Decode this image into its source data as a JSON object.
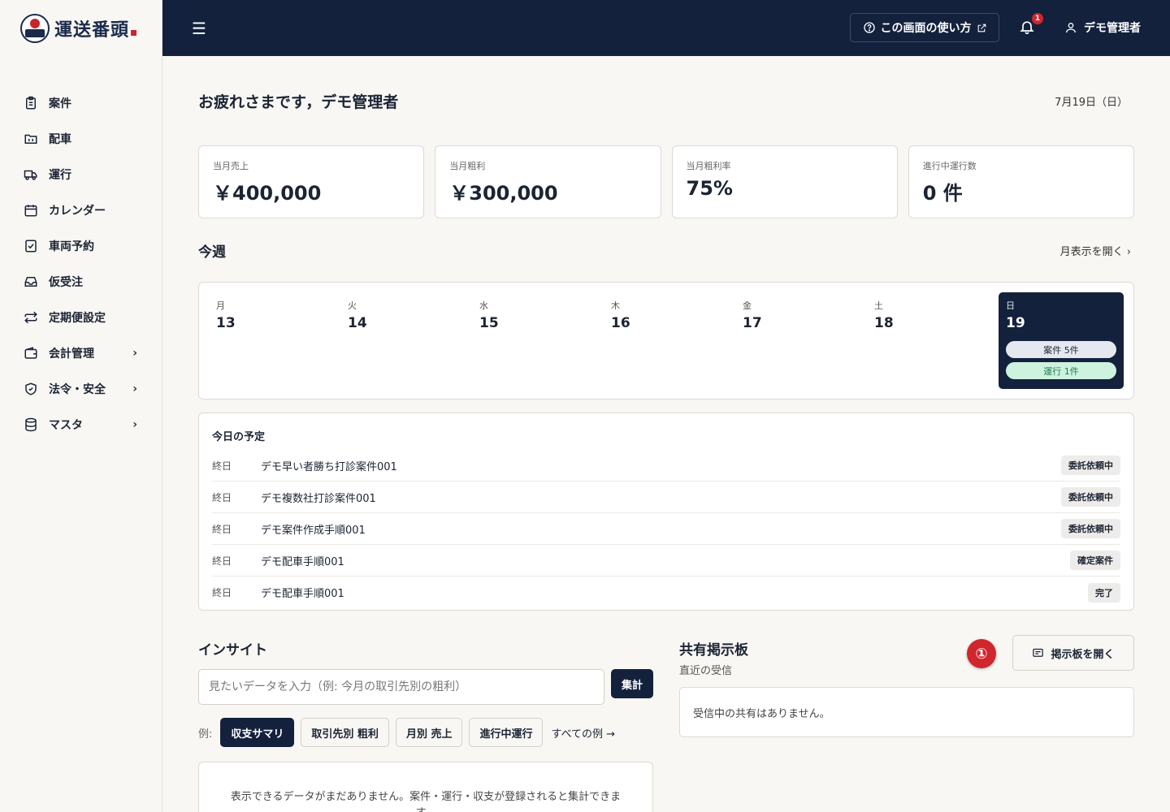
{
  "app": {
    "logo_text": "運送番頭"
  },
  "sidebar": {
    "items": [
      {
        "label": "案件",
        "icon": "clipboard-icon"
      },
      {
        "label": "配車",
        "icon": "folder-icon"
      },
      {
        "label": "運行",
        "icon": "truck-icon"
      },
      {
        "label": "カレンダー",
        "icon": "calendar-icon"
      },
      {
        "label": "車両予約",
        "icon": "checklist-icon"
      },
      {
        "label": "仮受注",
        "icon": "inbox-icon"
      },
      {
        "label": "定期便設定",
        "icon": "repeat-icon"
      },
      {
        "label": "会計管理",
        "icon": "wallet-icon",
        "expandable": true
      },
      {
        "label": "法令・安全",
        "icon": "shield-icon",
        "expandable": true
      },
      {
        "label": "マスタ",
        "icon": "database-icon",
        "expandable": true
      }
    ]
  },
  "header": {
    "help_label": "この画面の使い方",
    "notification_count": "1",
    "user_name": "デモ管理者"
  },
  "greeting": {
    "text": "お疲れさまです，デモ管理者",
    "date": "7月19日（日）"
  },
  "kpis": [
    {
      "label": "当月売上",
      "value": "￥400,000"
    },
    {
      "label": "当月粗利",
      "value": "￥300,000"
    },
    {
      "label": "当月粗利率",
      "value": "75%"
    },
    {
      "label": "進行中運行数",
      "value": "0 件"
    }
  ],
  "week": {
    "title": "今週",
    "open_month_label": "月表示を開く",
    "days": [
      {
        "name": "月",
        "num": "13"
      },
      {
        "name": "火",
        "num": "14"
      },
      {
        "name": "水",
        "num": "15"
      },
      {
        "name": "木",
        "num": "16"
      },
      {
        "name": "金",
        "num": "17"
      },
      {
        "name": "土",
        "num": "18"
      },
      {
        "name": "日",
        "num": "19"
      }
    ],
    "today_case_label": "案件 5件",
    "today_run_label": "運行 1件"
  },
  "schedule": {
    "title": "今日の予定",
    "rows": [
      {
        "when": "終日",
        "name": "デモ早い者勝ち打診案件001",
        "status": "委託依頼中"
      },
      {
        "when": "終日",
        "name": "デモ複数社打診案件001",
        "status": "委託依頼中"
      },
      {
        "when": "終日",
        "name": "デモ案件作成手順001",
        "status": "委託依頼中"
      },
      {
        "when": "終日",
        "name": "デモ配車手順001",
        "status": "確定案件"
      },
      {
        "when": "終日",
        "name": "デモ配車手順001",
        "status": "完了"
      }
    ]
  },
  "insight": {
    "title": "インサイト",
    "placeholder": "見たいデータを入力（例: 今月の取引先別の粗利）",
    "tally_label": "集計",
    "examples_label": "例:",
    "examples": [
      "収支サマリ",
      "取引先別 粗利",
      "月別 売上",
      "進行中運行"
    ],
    "all_examples_label": "すべての例 →",
    "empty_message": "表示できるデータがまだありません。案件・運行・収支が登録されると集計できます。"
  },
  "board": {
    "title": "共有掲示板",
    "subtitle": "直近の受信",
    "open_label": "掲示板を開く",
    "marker": "①",
    "empty_message": "受信中の共有はありません。"
  }
}
